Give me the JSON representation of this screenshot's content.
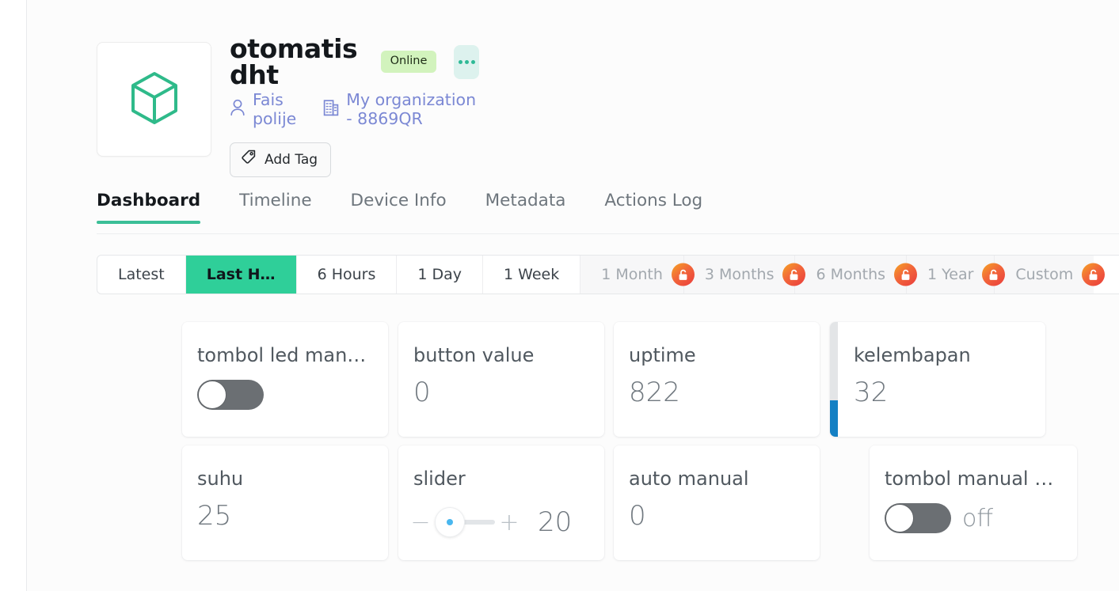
{
  "device": {
    "icon": "cube-icon",
    "title": "otomatis dht",
    "status": "Online",
    "owner": "Fais polije",
    "organization": "My organization - 8869QR",
    "add_tag_label": "Add Tag",
    "owner_icon": "user-icon",
    "org_icon": "building-icon",
    "tag_icon": "tag-icon",
    "more_icon": "more-horizontal-icon"
  },
  "tabs": [
    {
      "label": "Dashboard",
      "active": true
    },
    {
      "label": "Timeline",
      "active": false
    },
    {
      "label": "Device Info",
      "active": false
    },
    {
      "label": "Metadata",
      "active": false
    },
    {
      "label": "Actions Log",
      "active": false
    }
  ],
  "time_ranges": [
    {
      "label": "Latest",
      "active": false,
      "locked": false
    },
    {
      "label": "Last H…",
      "active": true,
      "locked": false
    },
    {
      "label": "6 Hours",
      "active": false,
      "locked": false
    },
    {
      "label": "1 Day",
      "active": false,
      "locked": false
    },
    {
      "label": "1 Week",
      "active": false,
      "locked": false
    },
    {
      "label": "1 Month",
      "active": false,
      "locked": true
    },
    {
      "label": "3 Months",
      "active": false,
      "locked": true
    },
    {
      "label": "6 Months",
      "active": false,
      "locked": true
    },
    {
      "label": "1 Year",
      "active": false,
      "locked": true
    },
    {
      "label": "Custom",
      "active": false,
      "locked": true
    }
  ],
  "widgets": [
    {
      "title": "tombol led man…",
      "type": "toggle",
      "toggle_state": "off",
      "toggle_label": ""
    },
    {
      "title": "button value",
      "type": "value",
      "value": "0"
    },
    {
      "title": "uptime",
      "type": "value",
      "value": "822"
    },
    {
      "title": "kelembapan",
      "type": "gauge",
      "value": "32",
      "fill_percent": 32,
      "fill_color": "#1480c4",
      "track_color": "#e3e5e7"
    },
    {
      "title": "suhu",
      "type": "value",
      "value": "25"
    },
    {
      "title": "slider",
      "type": "slider",
      "value": "20",
      "minus": "−",
      "plus": "+"
    },
    {
      "title": "auto manual",
      "type": "value",
      "value": "0"
    },
    {
      "title": "tombol manual …",
      "type": "toggle",
      "toggle_state": "off",
      "toggle_label": "off"
    }
  ],
  "colors": {
    "accent_green": "#3cbf97",
    "active_green": "#2fcf99",
    "status_bg": "#d2f3bd",
    "link_blue": "#7b88d4",
    "gauge_blue": "#1480c4",
    "lock_orange": "#f2673a"
  }
}
